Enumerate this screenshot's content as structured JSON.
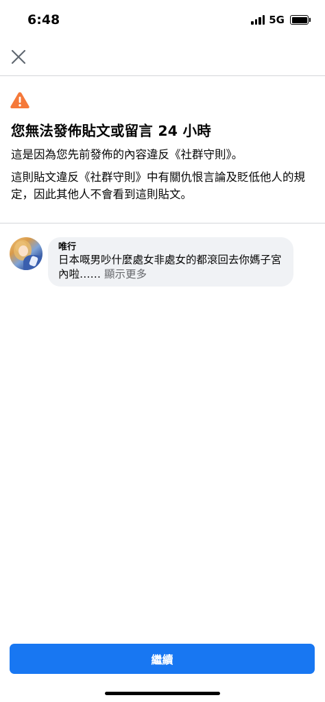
{
  "status_bar": {
    "time": "6:48",
    "network": "5G",
    "signal_icon": "signal-bars-icon",
    "battery_icon": "battery-icon"
  },
  "header": {
    "close_icon": "close-icon"
  },
  "notice": {
    "icon": "warning-icon",
    "icon_color": "#f5793a",
    "title": "您無法發佈貼文或留言 24 小時",
    "line1": "這是因為您先前發佈的內容違反《社群守則》。",
    "line2": "這則貼文違反《社群守則》中有關仇恨言論及貶低他人的規定，因此其他人不會看到這則貼文。"
  },
  "comment": {
    "author": "唯行",
    "text": "日本嘅男吵什麼處女非處女的都滾回去你媽子宮內啦……",
    "see_more": "顯示更多"
  },
  "actions": {
    "continue_label": "繼續",
    "accent_color": "#1877f2"
  }
}
